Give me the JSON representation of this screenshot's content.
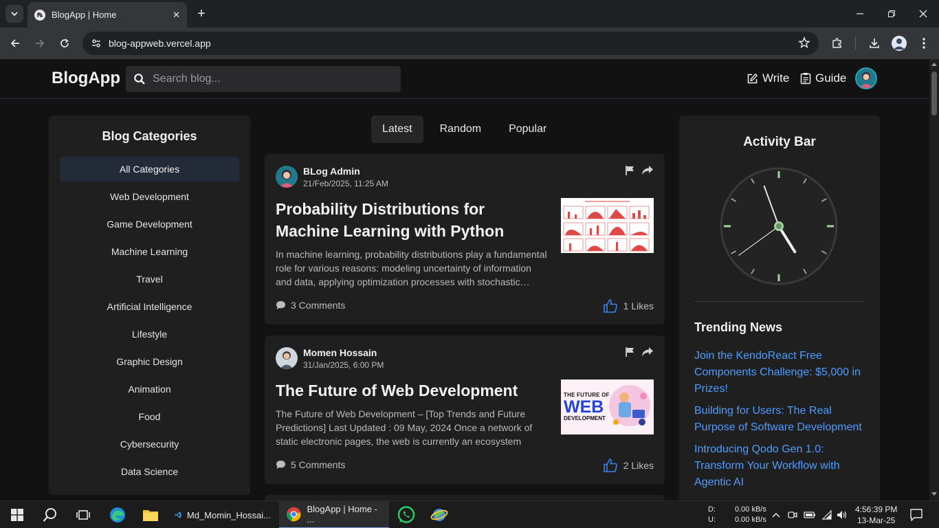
{
  "browser": {
    "tab_title": "BlogApp | Home",
    "url": "blog-appweb.vercel.app"
  },
  "header": {
    "logo": "BlogApp",
    "search_placeholder": "Search blog...",
    "write_label": "Write",
    "guide_label": "Guide"
  },
  "sidebar": {
    "title": "Blog Categories",
    "categories": [
      "All Categories",
      "Web Development",
      "Game Development",
      "Machine Learning",
      "Travel",
      "Artificial Intelligence",
      "Lifestyle",
      "Graphic Design",
      "Animation",
      "Food",
      "Cybersecurity",
      "Data Science"
    ]
  },
  "feed": {
    "tabs": [
      "Latest",
      "Random",
      "Popular"
    ],
    "posts": [
      {
        "author": "BLog Admin",
        "date": "21/Feb/2025, 11:25 AM",
        "title": "Probability Distributions for Machine Learning with Python",
        "excerpt": "In machine learning, probability distributions play a fundamental role for various reasons: modeling uncertainty of information and data, applying optimization processes with stochastic…",
        "comments": "3 Comments",
        "likes": "1 Likes"
      },
      {
        "author": "Momen Hossain",
        "date": "31/Jan/2025, 6:00 PM",
        "title": "The Future of Web Development",
        "excerpt": "The Future of Web Development – [Top Trends and Future Predictions] Last Updated : 09 May, 2024 Once a network of static electronic pages, the web is currently an ecosystem that’…",
        "comments": "5 Comments",
        "likes": "2 Likes",
        "thumb_text": [
          "THE FUTURE OF",
          "WEB",
          "DEVELOPMENT"
        ]
      }
    ]
  },
  "activity": {
    "title": "Activity Bar",
    "trending_title": "Trending News",
    "trending": [
      "Join the KendoReact Free Components Challenge: $5,000 in Prizes!",
      "Building for Users: The Real Purpose of Software Development",
      "Introducing Qodo Gen 1.0: Transform Your Workflow with Agentic AI"
    ]
  },
  "taskbar": {
    "vscode_label": "Md_Momin_Hossai...",
    "chrome_label": "BlogApp | Home - ...",
    "drive_d": "D:",
    "drive_u": "U:",
    "net_down": "0.00 kB/s",
    "net_up": "0.00 kB/s",
    "time": "4:56:39 PM",
    "date": "13-Mar-25"
  },
  "colors": {
    "accent_link": "#4e9cff",
    "like_blue": "#3b82f6",
    "clock_green": "#9fd49f"
  }
}
